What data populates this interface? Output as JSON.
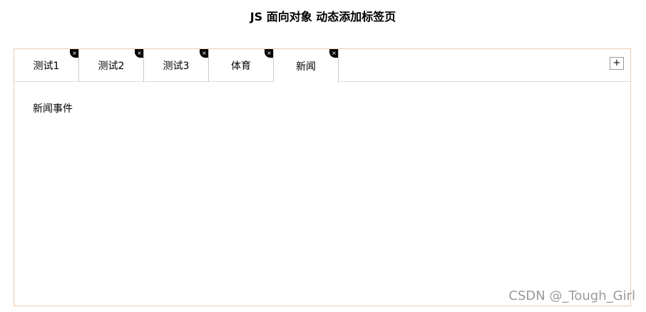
{
  "header": {
    "title": "JS 面向对象 动态添加标签页"
  },
  "tabs": {
    "items": [
      {
        "label": "测试1",
        "close": "×"
      },
      {
        "label": "测试2",
        "close": "×"
      },
      {
        "label": "测试3",
        "close": "×"
      },
      {
        "label": "体育",
        "close": "×"
      },
      {
        "label": "新闻",
        "close": "×"
      }
    ],
    "active_index": 4,
    "add_label": "+"
  },
  "content": {
    "text": "新闻事件"
  },
  "watermark": "CSDN @_Tough_Girl"
}
